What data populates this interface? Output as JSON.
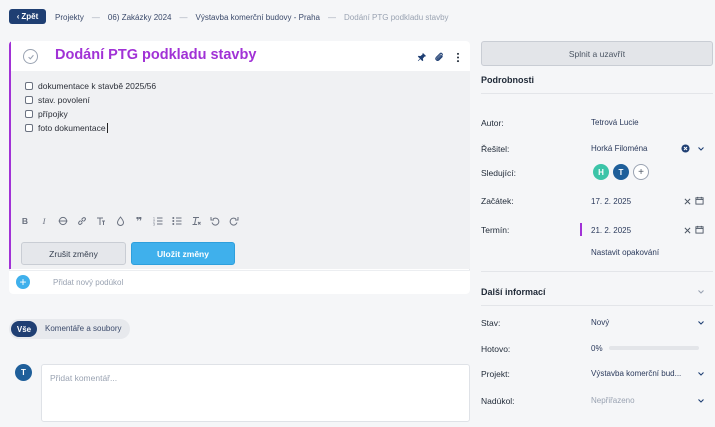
{
  "breadcrumb": {
    "back_label": "Zpět",
    "items": [
      "Projekty",
      "06) Zakázky 2024",
      "Výstavba komerční budovy - Praha",
      "Dodání PTG podkladu stavby"
    ]
  },
  "task": {
    "title": "Dodání PTG podkladu stavby",
    "checklist": [
      "dokumentace k stavbě 2025/56",
      "stav.  povolení",
      "přípojky",
      "foto dokumentace"
    ],
    "toolbar_icons": [
      "bold-icon",
      "italic-icon",
      "strikethrough-icon",
      "link-icon",
      "text-format-icon",
      "color-drop-icon",
      "quote-icon",
      "ordered-list-icon",
      "bullet-list-icon",
      "clear-format-icon",
      "undo-icon",
      "redo-icon"
    ],
    "cancel_label": "Zrušit změny",
    "save_label": "Uložit změny",
    "add_subtask_placeholder": "Přidat nový podúkol"
  },
  "activity": {
    "tabs": [
      "Vše",
      "Komentáře a soubory"
    ],
    "comment_placeholder": "Přidat komentář...",
    "user_initial": "T"
  },
  "details": {
    "complete_label": "Splnit a uzavřít",
    "section_title": "Podrobnosti",
    "author_label": "Autor:",
    "author": "Tetrová Lucie",
    "solver_label": "Řešitel:",
    "solver": "Horká Filoména",
    "followers_label": "Sledující:",
    "followers": [
      {
        "initial": "H",
        "color": "#3cc4a8"
      },
      {
        "initial": "T",
        "color": "#1f5f9a"
      }
    ],
    "add_follower": "+",
    "start_label": "Začátek:",
    "start": "17. 2. 2025",
    "deadline_label": "Termín:",
    "deadline": "21. 2. 2025",
    "repeat_label": "Nastavit opakování"
  },
  "more_info": {
    "section_title": "Další informací",
    "status_label": "Stav:",
    "status": "Nový",
    "done_label": "Hotovo:",
    "done_value": "0%",
    "done_fraction": 0,
    "project_label": "Projekt:",
    "project": "Výstavba komerční bud...",
    "parent_label": "Nadúkol:",
    "parent": "Nepřiřazeno"
  },
  "colors": {
    "accent_purple": "#a132d6",
    "primary_navy": "#1f3f73",
    "save_blue": "#3fb0ec"
  }
}
